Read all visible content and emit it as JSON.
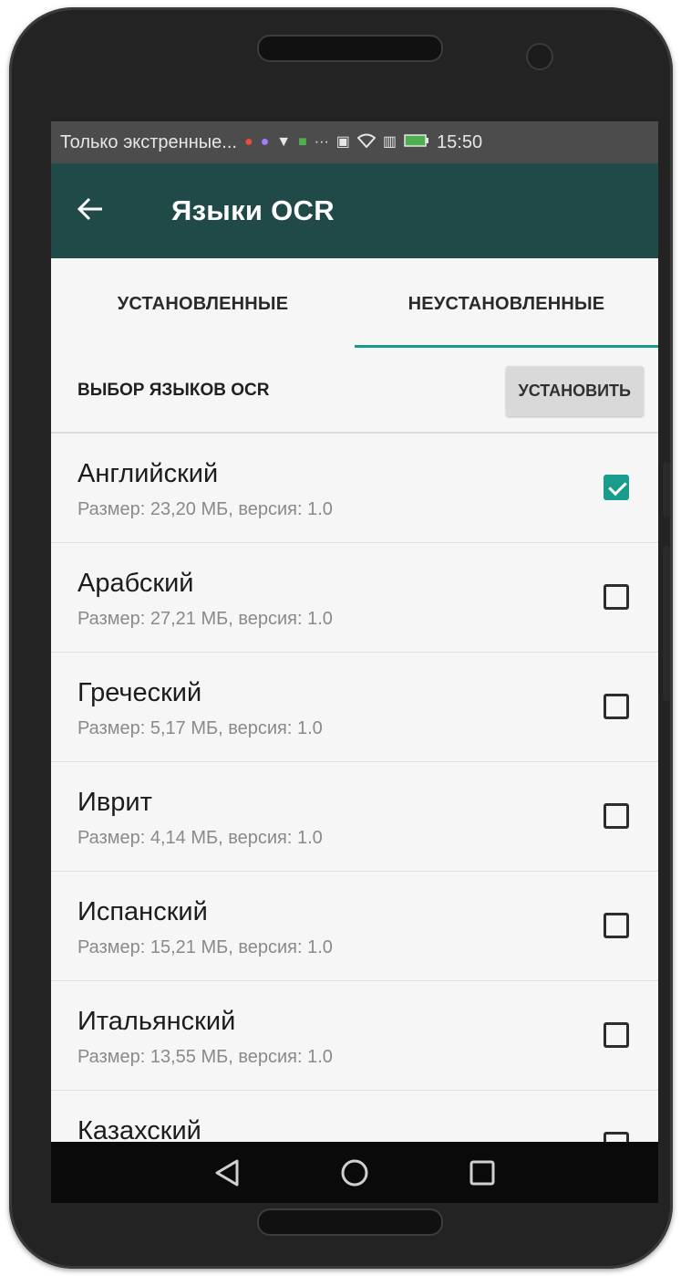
{
  "status_bar": {
    "message": "Только экстренные...",
    "time": "15:50",
    "icons": [
      "chat-icon",
      "app-icon",
      "shield-icon",
      "app-icon",
      "more-icon",
      "nfc-icon",
      "wifi-icon",
      "signal-icon",
      "battery-icon"
    ]
  },
  "app_bar": {
    "title": "Языки OCR"
  },
  "tabs": [
    {
      "label": "УСТАНОВЛЕННЫЕ",
      "active": false
    },
    {
      "label": "НЕУСТАНОВЛЕННЫЕ",
      "active": true
    }
  ],
  "section": {
    "label": "ВЫБОР ЯЗЫКОВ OCR",
    "install_button": "УСТАНОВИТЬ"
  },
  "languages": [
    {
      "name": "Английский",
      "info": "Размер: 23,20 МБ, версия: 1.0",
      "checked": true
    },
    {
      "name": "Арабский",
      "info": "Размер: 27,21 МБ, версия: 1.0",
      "checked": false
    },
    {
      "name": "Греческий",
      "info": "Размер: 5,17 МБ, версия: 1.0",
      "checked": false
    },
    {
      "name": "Иврит",
      "info": "Размер: 4,14 МБ, версия: 1.0",
      "checked": false
    },
    {
      "name": "Испанский",
      "info": "Размер: 15,21 МБ, версия: 1.0",
      "checked": false
    },
    {
      "name": "Итальянский",
      "info": "Размер: 13,55 МБ, версия: 1.0",
      "checked": false
    },
    {
      "name": "Казахский",
      "info": "",
      "checked": false
    }
  ],
  "colors": {
    "app_bar": "#1f4a48",
    "accent": "#1a9c8c",
    "status_bar": "#4c4c4c"
  }
}
